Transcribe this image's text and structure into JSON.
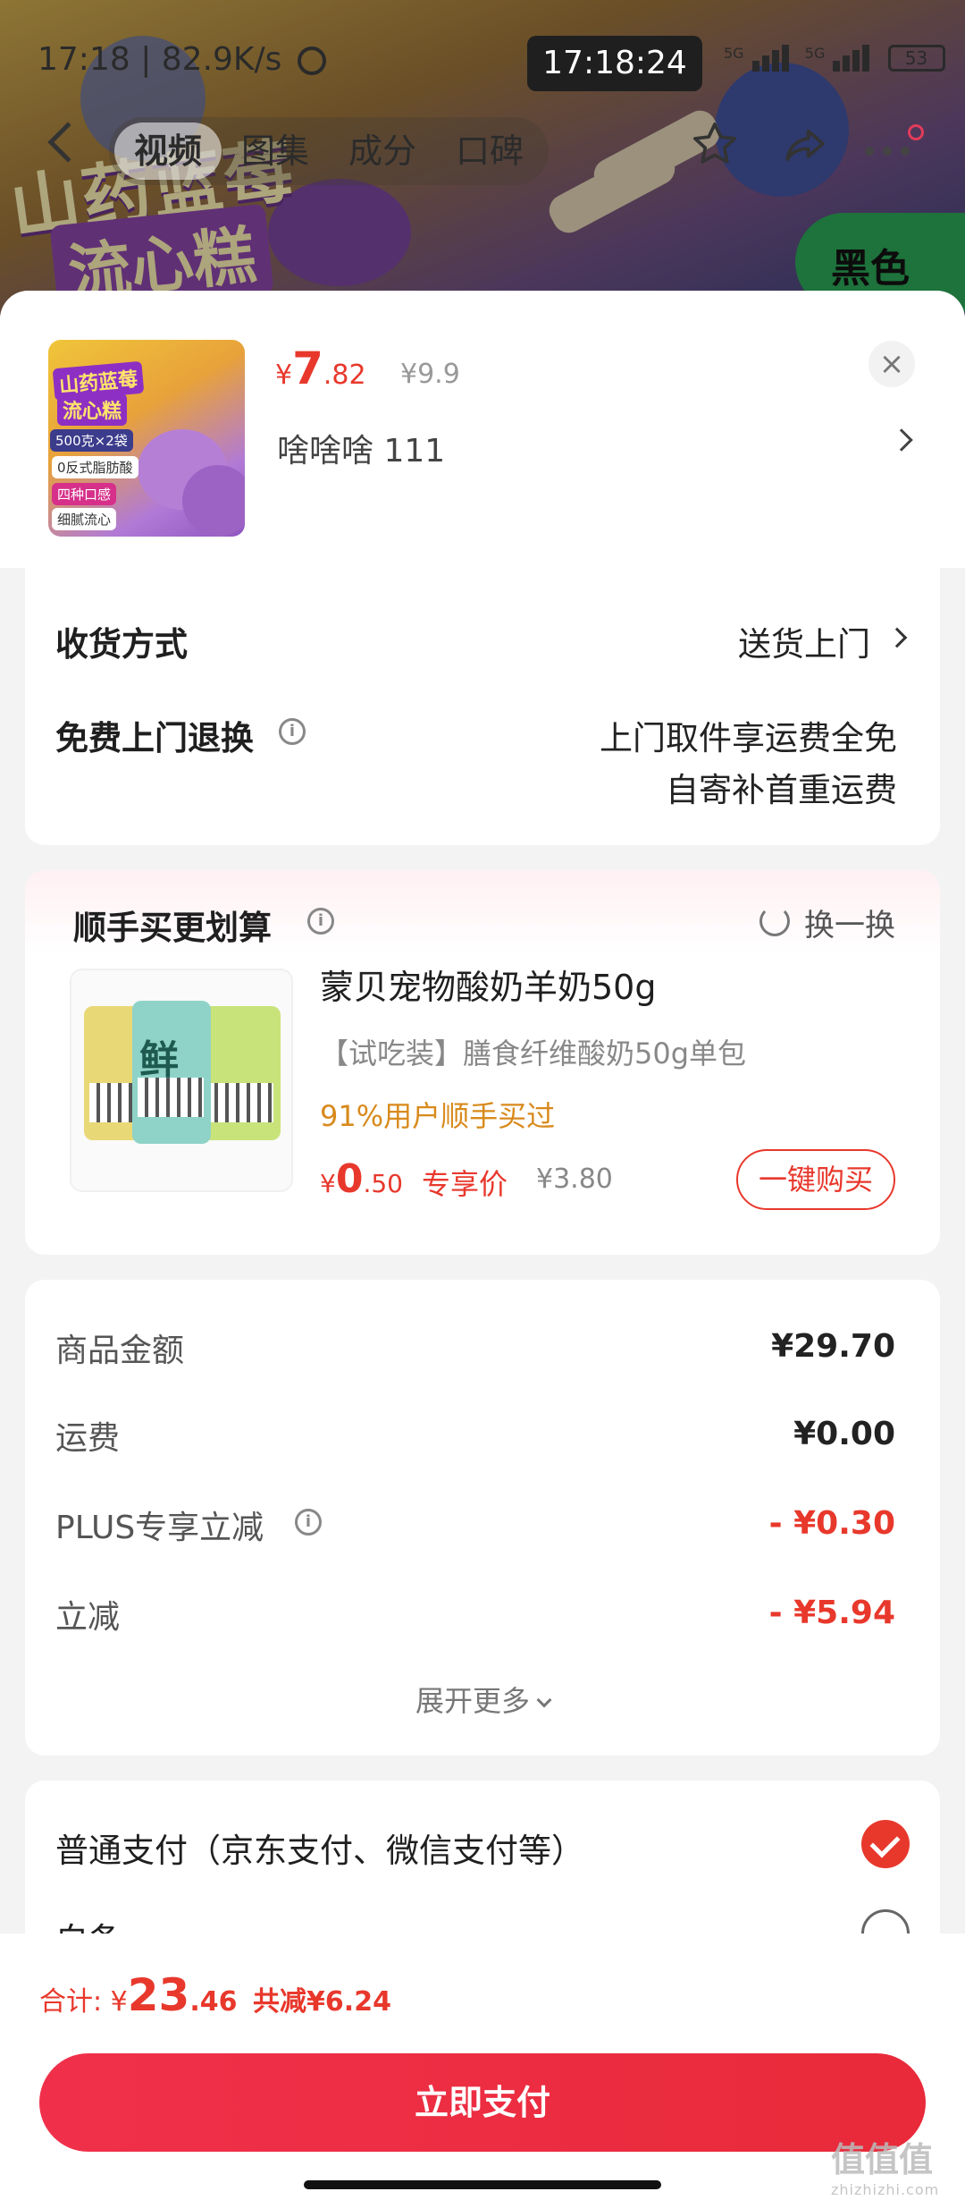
{
  "status_bar": {
    "left_text": "17:18 | 82.9K/s",
    "clock": "17:18:24",
    "network1": "5G",
    "network2": "5G",
    "battery": "53"
  },
  "hero": {
    "title_line1": "山药蓝莓",
    "title_line2": "流心糕",
    "badge": "黑色"
  },
  "nav": {
    "tabs": [
      "视频",
      "图集",
      "成分",
      "口碑"
    ],
    "active_tab": "视频"
  },
  "product": {
    "thumb_texts": [
      "山药蓝莓",
      "流心糕",
      "500克×2袋",
      "0反式脂肪酸",
      "四种口感",
      "细腻流心"
    ],
    "price_symbol": "¥",
    "price_int": "7",
    "price_dec": ".82",
    "original_price": "¥9.9",
    "spec": "啥啥啥  111"
  },
  "delivery": {
    "method_label": "收货方式",
    "method_value": "送货上门",
    "return_label": "免费上门退换",
    "return_value_line1": "上门取件享运费全免",
    "return_value_line2": "自寄补首重运费"
  },
  "upsell": {
    "title": "顺手买更划算",
    "refresh_label": "换一换",
    "thumb_label": "鲜",
    "name": "蒙贝宠物酸奶羊奶50g",
    "subtitle": "【试吃装】膳食纤维酸奶50g单包",
    "stat": "91%用户顺手买过",
    "price_symbol": "¥",
    "price_int": "0",
    "price_dec": ".50",
    "price_tag": "专享价",
    "original_price": "¥3.80",
    "buy_label": "一键购买"
  },
  "summary": {
    "rows": [
      {
        "label": "商品金额",
        "value": "¥29.70"
      },
      {
        "label": "运费",
        "value": "¥0.00"
      },
      {
        "label": "PLUS专享立减",
        "value": "- ¥0.30"
      },
      {
        "label": "立减",
        "value": "- ¥5.94"
      }
    ],
    "expand_label": "展开更多"
  },
  "payment": {
    "options": [
      {
        "label": "普通支付（京东支付、微信支付等）",
        "selected": true
      },
      {
        "label": "白条",
        "selected": false
      }
    ]
  },
  "footer": {
    "total_label": "合计:",
    "total_symbol": "¥",
    "total_int": "23",
    "total_dec": ".46",
    "reduce_text": "共减¥6.24",
    "pay_button": "立即支付",
    "watermark": "值值值",
    "watermark_sub": "zhizhizhi.com"
  },
  "colors": {
    "accent": "#e8382c",
    "stat_orange": "#d88a1c",
    "background": "#f3f3f3"
  }
}
